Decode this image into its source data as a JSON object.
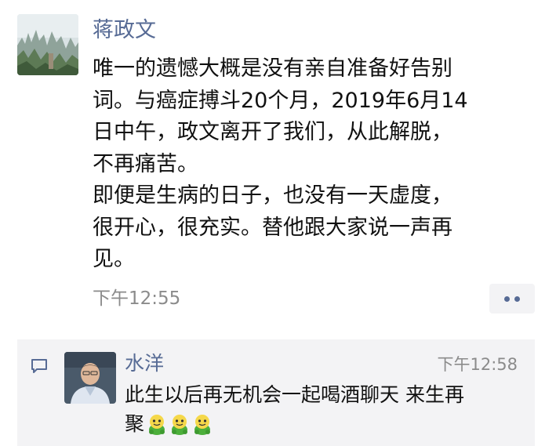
{
  "post": {
    "author": "蒋政文",
    "lines": [
      "唯一的遗憾大概是没有亲自准备好告别",
      "词。与癌症搏斗20个月，2019年6月14",
      "日中午，政文离开了我们，从此解脱，",
      "不再痛苦。",
      "即便是生病的日子，也没有一天虚度，",
      "很开心，很充实。替他跟大家说一声再",
      "见。"
    ],
    "time": "下午12:55"
  },
  "comment": {
    "author": "水洋",
    "time": "下午12:58",
    "lines": [
      "此生以后再无机会一起喝酒聊天 来生再",
      "聚"
    ],
    "emoji_count": 3,
    "emoji_icon": "frog-emoji"
  },
  "colors": {
    "name": "#576b95",
    "text": "#111111",
    "muted": "#8b8b8b",
    "panel": "#f3f3f5"
  }
}
